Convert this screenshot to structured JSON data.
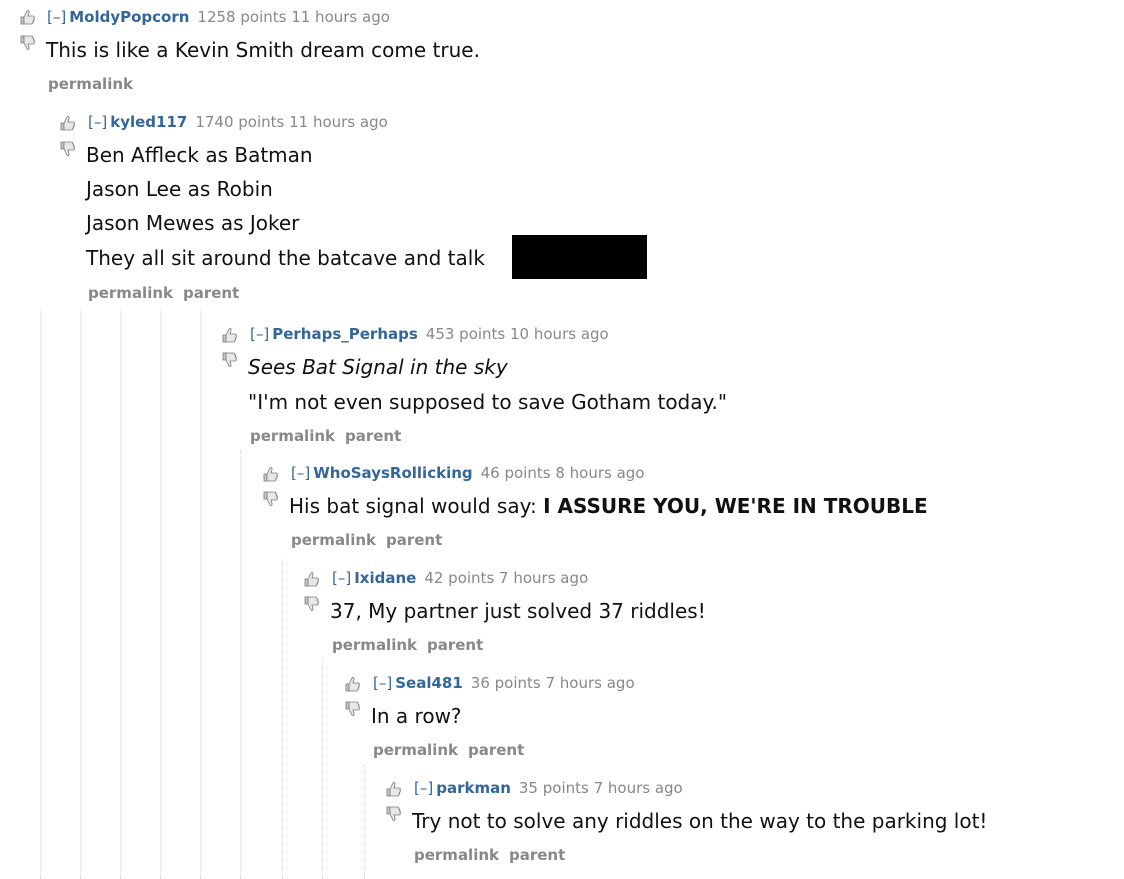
{
  "colors": {
    "author": "#336699",
    "meta": "#888888",
    "guide": "#dadada",
    "text": "#111111"
  },
  "icons": {
    "upvote": "thumbs-up-icon",
    "downvote": "thumbs-down-icon"
  },
  "comments": [
    {
      "toggle": "[–]",
      "author": "MoldyPopcorn",
      "meta": "1258 points 11 hours ago",
      "body": [
        "This is like a Kevin Smith dream come true."
      ],
      "buttons": [
        "permalink"
      ]
    },
    {
      "toggle": "[–]",
      "author": "kyled117",
      "meta": "1740 points 11 hours ago",
      "body": [
        "Ben Affleck as Batman",
        "Jason Lee as Robin",
        "Jason Mewes as Joker",
        "They all sit around the batcave and talk"
      ],
      "buttons": [
        "permalink",
        "parent"
      ]
    },
    {
      "toggle": "[–]",
      "author": "Perhaps_Perhaps",
      "meta": "453 points 10 hours ago",
      "body": [
        "Sees Bat Signal in the sky",
        "\"I'm not even supposed to save Gotham today.\""
      ],
      "buttons": [
        "permalink",
        "parent"
      ]
    },
    {
      "toggle": "[–]",
      "author": "WhoSaysRollicking",
      "meta": "46 points 8 hours ago",
      "body_prefix": "His bat signal would say: ",
      "body_bold": "I ASSURE YOU, WE'RE IN TROUBLE",
      "buttons": [
        "permalink",
        "parent"
      ]
    },
    {
      "toggle": "[–]",
      "author": "Ixidane",
      "meta": "42 points 7 hours ago",
      "body": [
        "37, My partner just solved 37 riddles!"
      ],
      "buttons": [
        "permalink",
        "parent"
      ]
    },
    {
      "toggle": "[–]",
      "author": "Seal481",
      "meta": "36 points 7 hours ago",
      "body": [
        "In a row?"
      ],
      "buttons": [
        "permalink",
        "parent"
      ]
    },
    {
      "toggle": "[–]",
      "author": "parkman",
      "meta": "35 points 7 hours ago",
      "body": [
        "Try not to solve any riddles on the way to the parking lot!"
      ],
      "buttons": [
        "permalink",
        "parent"
      ]
    }
  ]
}
